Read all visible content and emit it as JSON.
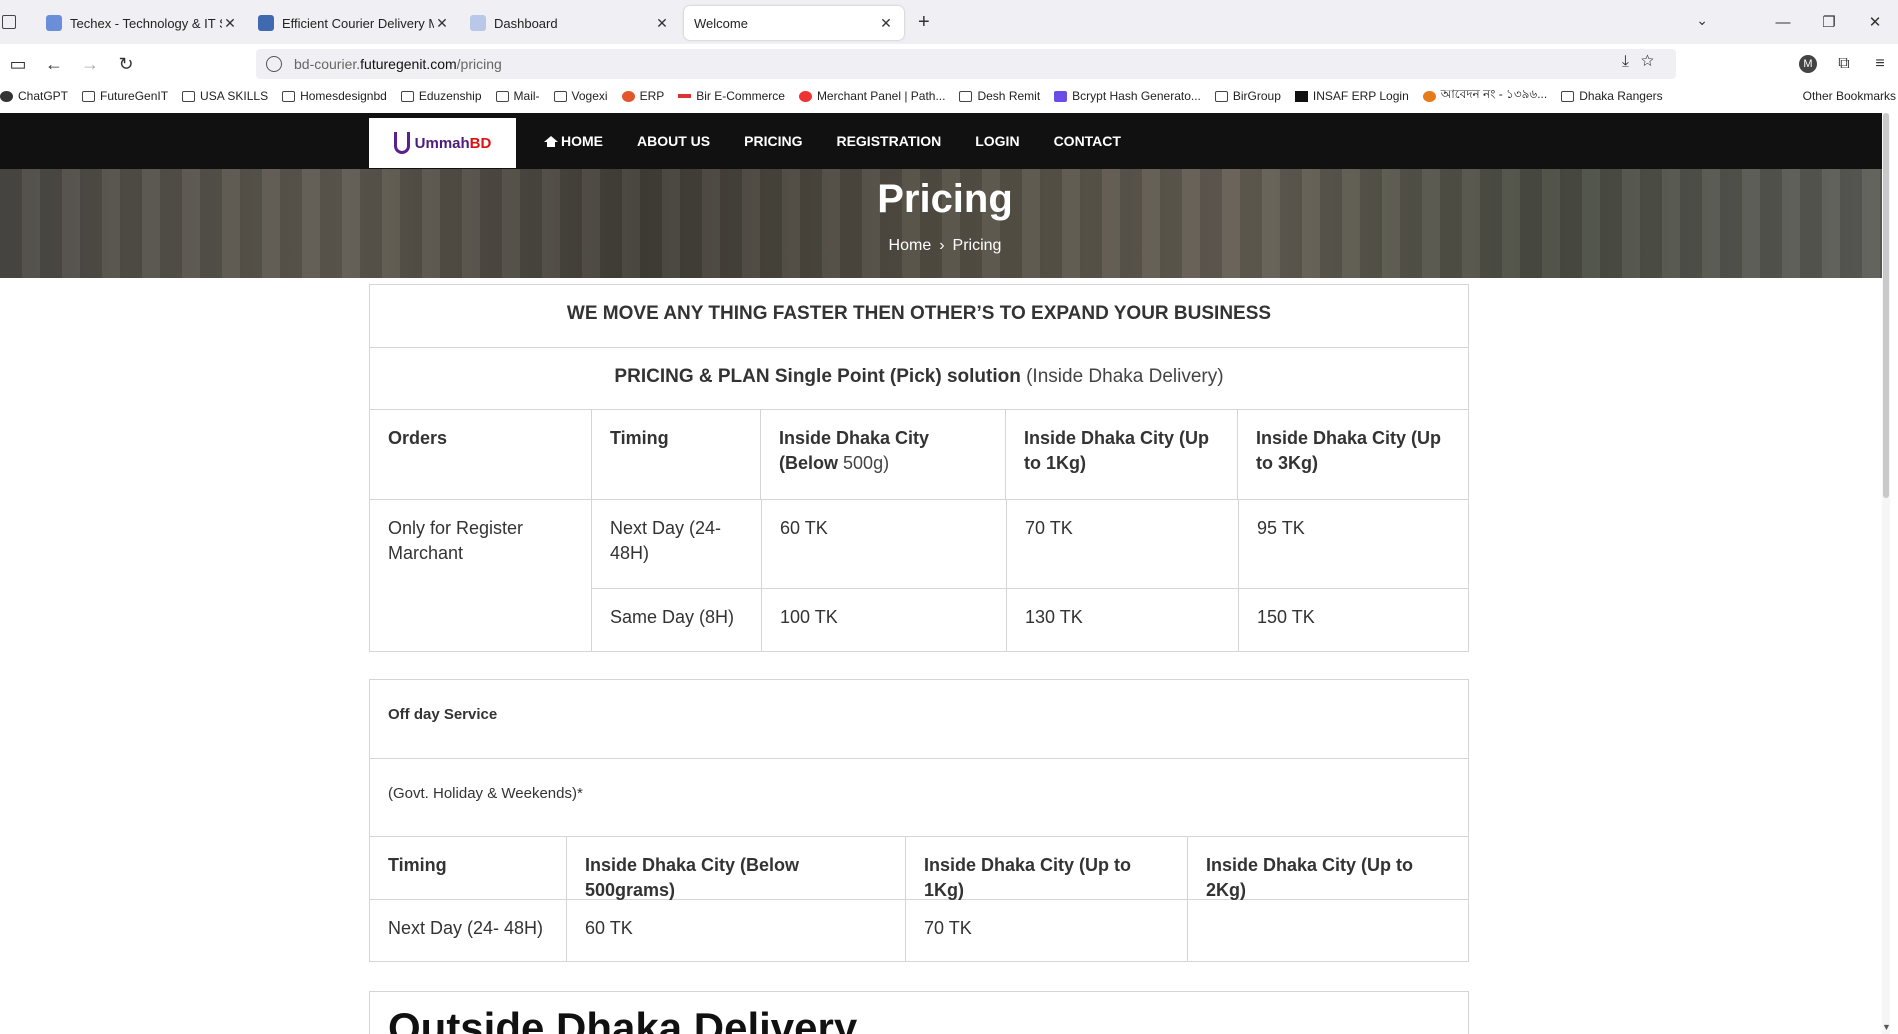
{
  "browser": {
    "tabs": [
      {
        "title": "Techex - Technology & IT Servic",
        "active": false
      },
      {
        "title": "Efficient Courier Delivery Manag",
        "active": false
      },
      {
        "title": "Dashboard",
        "active": false
      },
      {
        "title": "Welcome",
        "active": true
      }
    ],
    "url_prefix": "bd-courier.",
    "url_domain": "futuregenit.com",
    "url_path": "/pricing",
    "profile_initial": "M",
    "bookmarks": [
      "ChatGPT",
      "FutureGenIT",
      "USA SKILLS",
      "Homesdesignbd",
      "Eduzenship",
      "Mail-",
      "Vogexi",
      "ERP",
      "Bir E-Commerce",
      "Merchant Panel | Path...",
      "Desh Remit",
      "Bcrypt Hash Generato...",
      "BirGroup",
      "INSAF ERP Login",
      "আবেদন নং - ১৩৯৬...",
      "Dhaka Rangers"
    ],
    "other_bookmarks": "Other Bookmarks"
  },
  "site": {
    "logo": {
      "part1": "Ummah",
      "part2": "BD"
    },
    "menu": {
      "home": "HOME",
      "about": "ABOUT US",
      "pricing": "PRICING",
      "registration": "REGISTRATION",
      "login": "LOGIN",
      "contact": "CONTACT"
    },
    "hero": {
      "title": "Pricing",
      "crumb_home": "Home",
      "crumb_sep": "›",
      "crumb_current": "Pricing"
    },
    "table1": {
      "headline": "WE MOVE ANY THING FASTER THEN OTHER’S TO EXPAND YOUR BUSINESS",
      "plan_bold": "PRICING & PLAN  Single Point (Pick) solution",
      "plan_normal": " (Inside Dhaka Delivery)",
      "headers": {
        "orders": "Orders",
        "timing": "Timing",
        "h1_bold": "Inside Dhaka City (Below",
        "h1_normal": "500g)",
        "h2_bold": "Inside Dhaka City (Up to",
        "h2_normal": "1Kg)",
        "h3_bold": "Inside Dhaka City (Up to",
        "h3_normal": "3Kg)"
      },
      "order_type": "Only for Register Marchant",
      "rows": [
        {
          "timing": "Next Day (24-48H)",
          "p1": "60 TK",
          "p2": "70 TK",
          "p3": "95 TK"
        },
        {
          "timing": "Same Day (8H)",
          "p1": "100 TK",
          "p2": "130 TK",
          "p3": "150 TK"
        }
      ]
    },
    "table2": {
      "title": "Off day Service",
      "note": "(Govt. Holiday & Weekends)*",
      "headers": {
        "timing": "Timing",
        "h1": "Inside Dhaka City (Below 500grams)",
        "h2": "Inside Dhaka City (Up to 1Kg)",
        "h3": "Inside Dhaka City (Up to 2Kg)"
      },
      "row": {
        "timing": "Next Day (24- 48H)",
        "p1": "60 TK",
        "p2": "70 TK",
        "p3": ""
      }
    },
    "outside": {
      "title": "Outside Dhaka Delivery"
    }
  }
}
